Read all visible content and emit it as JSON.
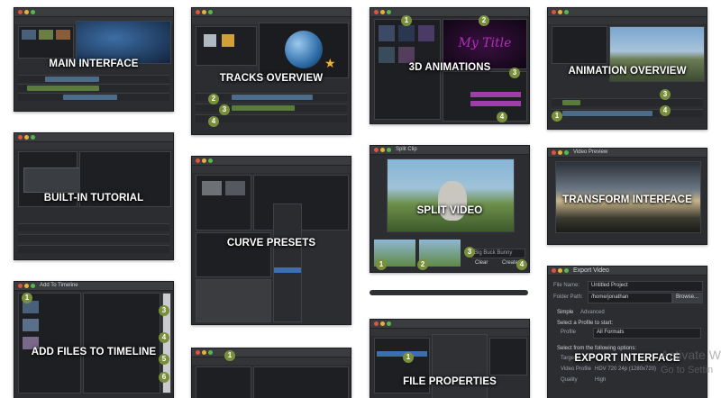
{
  "tiles": {
    "main_interface": {
      "label": "MAIN INTERFACE"
    },
    "tracks_overview": {
      "label": "TRACKS OVERVIEW"
    },
    "animations_3d": {
      "label": "3D ANIMATIONS",
      "preview_text": "My Title"
    },
    "animation_overview": {
      "label": "ANIMATION OVERVIEW"
    },
    "builtin_tutorial": {
      "label": "BUILT-IN TUTORIAL"
    },
    "curve_presets": {
      "label": "CURVE PRESETS"
    },
    "split_video": {
      "label": "SPLIT VIDEO",
      "window_title": "Split Clip",
      "name_field": "Big Buck Bunny",
      "clear_btn": "Clear",
      "create_btn": "Create"
    },
    "transform_interface": {
      "label": "TRANSFORM INTERFACE",
      "window_title": "Video Preview"
    },
    "add_files": {
      "label": "ADD FILES TO TIMELINE",
      "window_title": "Add To Timeline"
    },
    "file_properties": {
      "label": "FILE PROPERTIES"
    },
    "export_interface": {
      "label": "EXPORT INTERFACE",
      "window_title": "Export Video",
      "file_name_label": "File Name:",
      "file_name_value": "Untitled Project",
      "folder_label": "Folder Path:",
      "folder_value": "/home/jonathan",
      "browse_btn": "Browse...",
      "tab_simple": "Simple",
      "tab_advanced": "Advanced",
      "profile_heading": "Select a Profile to start:",
      "profile_label": "Profile",
      "profile_value": "All Formats",
      "options_heading": "Select from the following options:",
      "target_label": "Target",
      "video_profile_label": "Video Profile",
      "video_profile_value": "HDV 720 24p (1280x720)",
      "quality_label": "Quality",
      "quality_value": "High"
    }
  },
  "watermark": {
    "line1": "Activate W",
    "line2": "Go to Settin"
  },
  "colors": {
    "tile_bg": "#2b2d31",
    "badge": "#7a8f3c",
    "label": "#ffffff"
  }
}
